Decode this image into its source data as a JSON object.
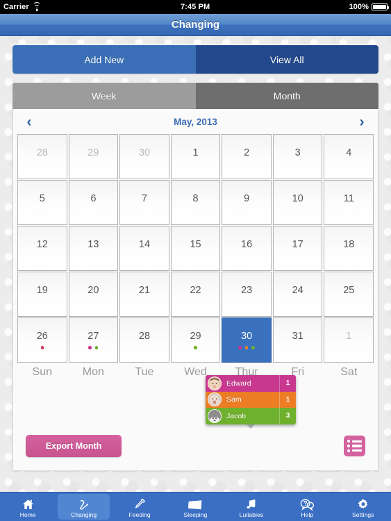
{
  "statusbar": {
    "carrier": "Carrier",
    "wifi_icon": "wifi-icon",
    "time": "7:45 PM",
    "battery_pct": "100%",
    "battery_icon": "battery-full-icon"
  },
  "titlebar": {
    "title": "Changing"
  },
  "segments": {
    "primary": [
      {
        "label": "Add New",
        "active": false
      },
      {
        "label": "View All",
        "active": true
      }
    ],
    "range": [
      {
        "label": "Week",
        "active": false
      },
      {
        "label": "Month",
        "active": true
      }
    ]
  },
  "monthnav": {
    "prev_icon": "chevron-left-icon",
    "next_icon": "chevron-right-icon",
    "label": "May, 2013"
  },
  "calendar": {
    "weekdays": [
      "Sun",
      "Mon",
      "Tue",
      "Wed",
      "Thur",
      "Fri",
      "Sat"
    ],
    "rows": [
      [
        {
          "day": "28",
          "muted": true,
          "selected": false,
          "dots": []
        },
        {
          "day": "29",
          "muted": true,
          "selected": false,
          "dots": []
        },
        {
          "day": "30",
          "muted": true,
          "selected": false,
          "dots": []
        },
        {
          "day": "1",
          "muted": false,
          "selected": false,
          "dots": []
        },
        {
          "day": "2",
          "muted": false,
          "selected": false,
          "dots": []
        },
        {
          "day": "3",
          "muted": false,
          "selected": false,
          "dots": []
        },
        {
          "day": "4",
          "muted": false,
          "selected": false,
          "dots": []
        }
      ],
      [
        {
          "day": "5",
          "muted": false,
          "selected": false,
          "dots": []
        },
        {
          "day": "6",
          "muted": false,
          "selected": false,
          "dots": []
        },
        {
          "day": "7",
          "muted": false,
          "selected": false,
          "dots": []
        },
        {
          "day": "8",
          "muted": false,
          "selected": false,
          "dots": []
        },
        {
          "day": "9",
          "muted": false,
          "selected": false,
          "dots": []
        },
        {
          "day": "10",
          "muted": false,
          "selected": false,
          "dots": []
        },
        {
          "day": "11",
          "muted": false,
          "selected": false,
          "dots": []
        }
      ],
      [
        {
          "day": "12",
          "muted": false,
          "selected": false,
          "dots": []
        },
        {
          "day": "13",
          "muted": false,
          "selected": false,
          "dots": []
        },
        {
          "day": "14",
          "muted": false,
          "selected": false,
          "dots": []
        },
        {
          "day": "15",
          "muted": false,
          "selected": false,
          "dots": []
        },
        {
          "day": "16",
          "muted": false,
          "selected": false,
          "dots": []
        },
        {
          "day": "17",
          "muted": false,
          "selected": false,
          "dots": []
        },
        {
          "day": "18",
          "muted": false,
          "selected": false,
          "dots": []
        }
      ],
      [
        {
          "day": "19",
          "muted": false,
          "selected": false,
          "dots": []
        },
        {
          "day": "20",
          "muted": false,
          "selected": false,
          "dots": []
        },
        {
          "day": "21",
          "muted": false,
          "selected": false,
          "dots": []
        },
        {
          "day": "22",
          "muted": false,
          "selected": false,
          "dots": []
        },
        {
          "day": "23",
          "muted": false,
          "selected": false,
          "dots": []
        },
        {
          "day": "24",
          "muted": false,
          "selected": false,
          "dots": []
        },
        {
          "day": "25",
          "muted": false,
          "selected": false,
          "dots": []
        }
      ],
      [
        {
          "day": "26",
          "muted": false,
          "selected": false,
          "dots": [
            "#d03a5e"
          ]
        },
        {
          "day": "27",
          "muted": false,
          "selected": false,
          "dots": [
            "#c9388f",
            "#6fb02d"
          ]
        },
        {
          "day": "28",
          "muted": false,
          "selected": false,
          "dots": []
        },
        {
          "day": "29",
          "muted": false,
          "selected": false,
          "dots": [
            "#6fb02d"
          ]
        },
        {
          "day": "30",
          "muted": false,
          "selected": true,
          "dots": [
            "#c9388f",
            "#e8812a",
            "#6fb02d"
          ]
        },
        {
          "day": "31",
          "muted": false,
          "selected": false,
          "dots": []
        },
        {
          "day": "1",
          "muted": true,
          "selected": false,
          "dots": []
        }
      ]
    ]
  },
  "popover": {
    "anchor_day": "23",
    "caret_icon": "caret-down-icon",
    "rows": [
      {
        "name": "Edward",
        "count": "1",
        "color": "#c9388f",
        "avatar": "baby-avatar-edward"
      },
      {
        "name": "Sam",
        "count": "1",
        "color": "#ec7d25",
        "avatar": "baby-avatar-sam"
      },
      {
        "name": "Jacob",
        "count": "3",
        "color": "#6fb02d",
        "avatar": "baby-avatar-jacob"
      }
    ]
  },
  "footer": {
    "export_label": "Export Month",
    "list_icon": "list-view-icon"
  },
  "tabbar": {
    "items": [
      {
        "label": "Home",
        "icon": "home-icon",
        "active": false
      },
      {
        "label": "Changing",
        "icon": "pin-icon",
        "active": true
      },
      {
        "label": "Feeding",
        "icon": "bottle-icon",
        "active": false
      },
      {
        "label": "Sleeping",
        "icon": "pillow-icon",
        "active": false
      },
      {
        "label": "Lullabies",
        "icon": "music-icon",
        "active": false
      },
      {
        "label": "Help",
        "icon": "question-bubble-icon",
        "active": false
      },
      {
        "label": "Settings",
        "icon": "gear-icon",
        "active": false
      }
    ]
  },
  "colors": {
    "accent_blue": "#3a6fc4",
    "selected_blue": "#3971bf",
    "pink": "#d4629f",
    "edward": "#c9388f",
    "sam": "#ec7d25",
    "jacob": "#6fb02d"
  }
}
